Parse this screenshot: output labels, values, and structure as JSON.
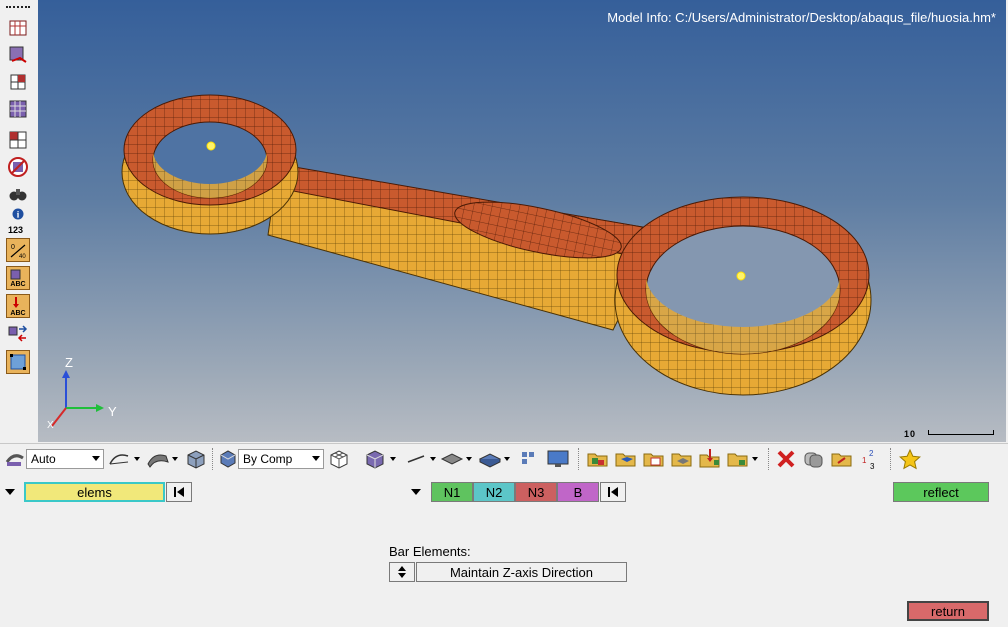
{
  "viewport": {
    "model_info": "Model Info: C:/Users/Administrator/Desktop/abaqus_file/huosia.hm*",
    "scale_label": "10",
    "axis_z": "Z",
    "axis_y": "Y",
    "axis_x": "X"
  },
  "left_toolbar": {
    "number_label": "123",
    "icons": [
      "hidden-line-icon",
      "shaded-mask-icon",
      "element-mask-icon",
      "mesh-icon",
      "mesh-feature-icon",
      "no-entry-icon",
      "binoculars-find-icon",
      "info-icon",
      "measure-icon",
      "abc-label-icon",
      "abc-arrow-icon",
      "swap-arrows-icon",
      "frame-icon"
    ]
  },
  "toolbar": {
    "auto_dropdown": "Auto",
    "by_comp_dropdown": "By Comp"
  },
  "panel": {
    "elems_label": "elems",
    "n1_label": "N1",
    "n2_label": "N2",
    "n3_label": "N3",
    "b_label": "B",
    "reflect_label": "reflect",
    "bar_elements_label": "Bar Elements:",
    "direction_value": "Maintain Z-axis Direction",
    "return_label": "return"
  },
  "colors": {
    "viewport_top": "#355f9a",
    "viewport_bottom": "#b7bcc3",
    "mesh_orange": "#c95a2e",
    "mesh_yellow": "#e7a935",
    "elems_yellow": "#f1e87a",
    "n_green": "#5fc35f",
    "n2_teal": "#5cc6c8",
    "n3_red": "#cc6060",
    "b_purple": "#c066c8",
    "reflect_green": "#5cc85c",
    "return_red": "#d8696a"
  }
}
